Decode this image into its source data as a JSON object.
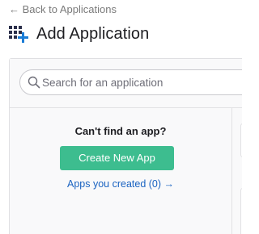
{
  "nav": {
    "back_link": "← Back to Applications"
  },
  "header": {
    "icon": "apps-grid-add-icon",
    "title": "Add Application"
  },
  "search": {
    "icon": "search-icon",
    "placeholder": "Search for an application",
    "value": ""
  },
  "empty_state": {
    "heading": "Can't find an app?",
    "create_button_label": "Create New App",
    "apps_created_link": "Apps you created (0) →"
  },
  "colors": {
    "accent_green": "#3dbd8f",
    "link_blue": "#1a63c1",
    "icon_navy": "#2b2f4a",
    "icon_plus_blue": "#1a7cd6"
  }
}
